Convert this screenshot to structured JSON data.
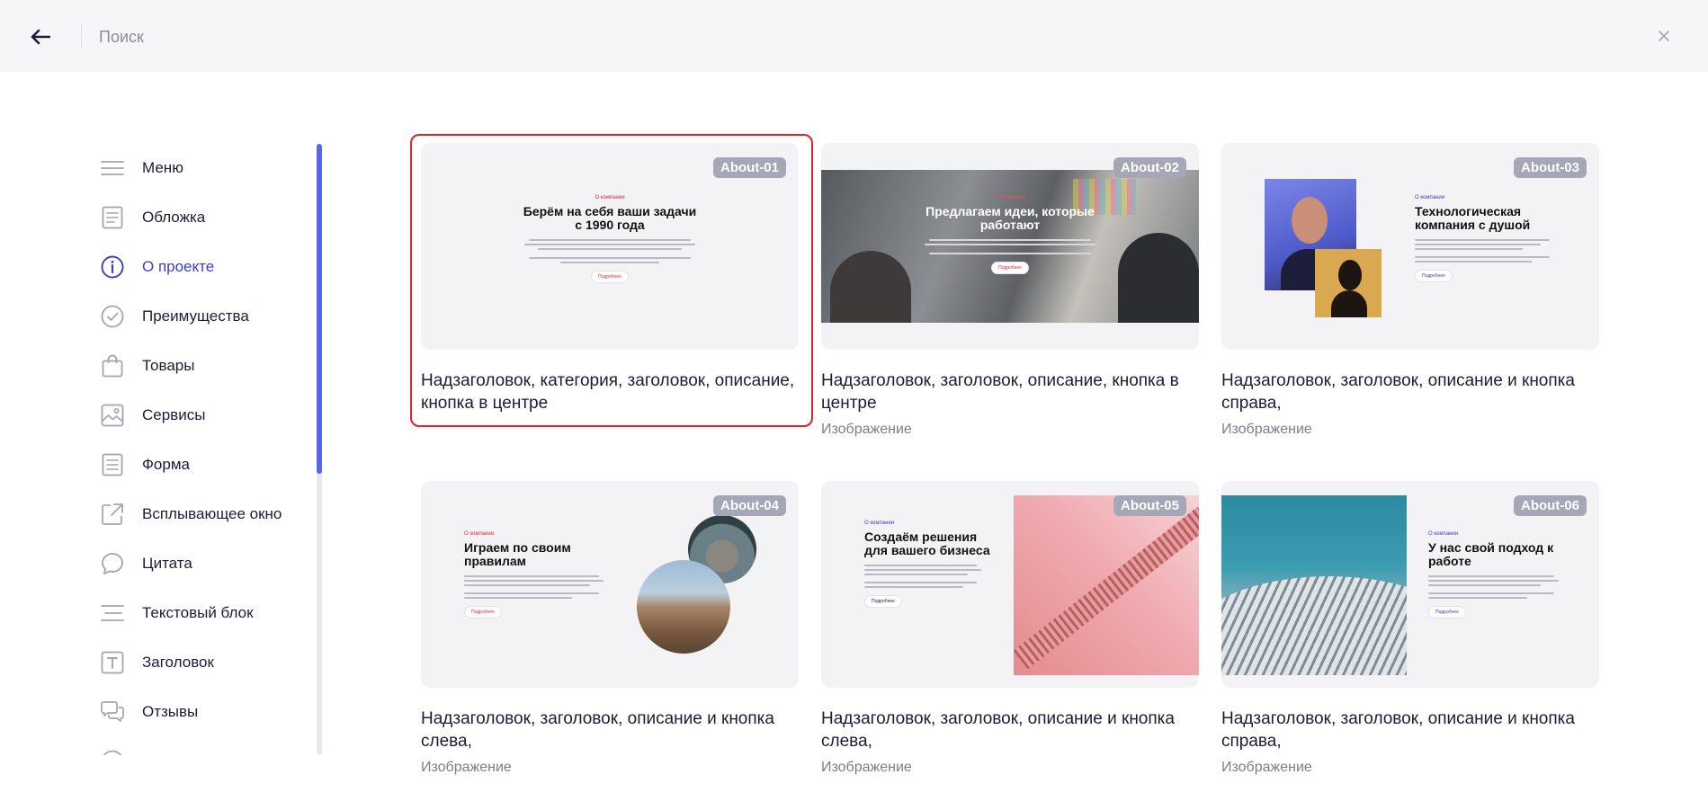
{
  "topbar": {
    "search_placeholder": "Поиск"
  },
  "sidebar": {
    "items": [
      {
        "label": "Меню",
        "icon": "menu-lines-icon"
      },
      {
        "label": "Обложка",
        "icon": "document-icon"
      },
      {
        "label": "О проекте",
        "icon": "info-icon",
        "active": true
      },
      {
        "label": "Преимущества",
        "icon": "check-circle-icon"
      },
      {
        "label": "Товары",
        "icon": "shopping-bag-icon"
      },
      {
        "label": "Сервисы",
        "icon": "image-icon"
      },
      {
        "label": "Форма",
        "icon": "form-icon"
      },
      {
        "label": "Всплывающее окно",
        "icon": "external-link-icon"
      },
      {
        "label": "Цитата",
        "icon": "speech-bubble-icon"
      },
      {
        "label": "Текстовый блок",
        "icon": "text-lines-icon"
      },
      {
        "label": "Заголовок",
        "icon": "text-t-icon"
      },
      {
        "label": "Отзывы",
        "icon": "chat-bubbles-icon"
      }
    ]
  },
  "cards": [
    {
      "badge": "About-01",
      "title": "Надзаголовок, категория, заголовок, описание, кнопка в центре",
      "subtitle": "",
      "preview": {
        "eyebrow": "О компании",
        "heading": "Берём на себя ваши задачи с 1990 года",
        "button": "Подробнее"
      }
    },
    {
      "badge": "About-02",
      "title": "Надзаголовок, заголовок, описание, кнопка в центре",
      "subtitle": "Изображение",
      "preview": {
        "eyebrow": "О компании",
        "heading": "Предлагаем идеи, которые работают",
        "button": "Подробнее"
      }
    },
    {
      "badge": "About-03",
      "title": "Надзаголовок, заголовок, описание и кнопка справа,",
      "subtitle": "Изображение",
      "preview": {
        "eyebrow": "О компании",
        "heading": "Технологическая компания с душой",
        "button": "Подробнее"
      }
    },
    {
      "badge": "About-04",
      "title": "Надзаголовок, заголовок, описание и кнопка слева,",
      "subtitle": "Изображение",
      "preview": {
        "eyebrow": "О компании",
        "heading": "Играем по своим правилам",
        "button": "Подробнее"
      }
    },
    {
      "badge": "About-05",
      "title": "Надзаголовок, заголовок, описание и кнопка слева,",
      "subtitle": "Изображение",
      "preview": {
        "eyebrow": "О компании",
        "heading": "Создаём решения для вашего бизнеса",
        "button": "Подробнее"
      }
    },
    {
      "badge": "About-06",
      "title": "Надзаголовок, заголовок, описание и кнопка справа,",
      "subtitle": "Изображение",
      "preview": {
        "eyebrow": "О компании",
        "heading": "У нас свой подход к работе",
        "button": "Подробнее"
      }
    }
  ],
  "colors": {
    "accent": "#3a3fc4",
    "scrollbar": "#5866e8",
    "selection": "#e3202b",
    "badge": "#a5a6b6"
  }
}
